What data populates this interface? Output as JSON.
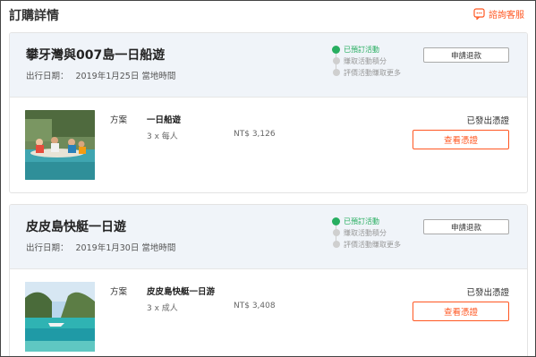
{
  "header": {
    "title": "訂購詳情",
    "customer_service": "諮詢客服"
  },
  "orders": [
    {
      "title": "攀牙灣與007島一日船遊",
      "date_label": "出行日期：",
      "date_value": "2019年1月25日 當地時間",
      "timeline": [
        "已預訂活動",
        "賺取活動積分",
        "評價活動賺取更多"
      ],
      "refund_label": "申請退款",
      "plan_key": "方案",
      "plan_name": "一日船遊",
      "quantity": "3 x 每人",
      "price": "NT$ 3,126",
      "voucher_status": "已發出憑證",
      "voucher_button": "查看憑證",
      "image": "sea-canoe-photo"
    },
    {
      "title": "皮皮島快艇一日遊",
      "date_label": "出行日期：",
      "date_value": "2019年1月30日 當地時間",
      "timeline": [
        "已預訂活動",
        "賺取活動積分",
        "評價活動賺取更多"
      ],
      "refund_label": "申請退款",
      "plan_key": "方案",
      "plan_name": "皮皮島快艇一日游",
      "quantity": "3 x 成人",
      "price": "NT$ 3,408",
      "voucher_status": "已發出憑證",
      "voucher_button": "查看憑證",
      "image": "phi-phi-island-photo"
    }
  ],
  "colors": {
    "accent": "#ff5722",
    "success": "#27ae60",
    "header_bg": "#f0f4f9"
  }
}
